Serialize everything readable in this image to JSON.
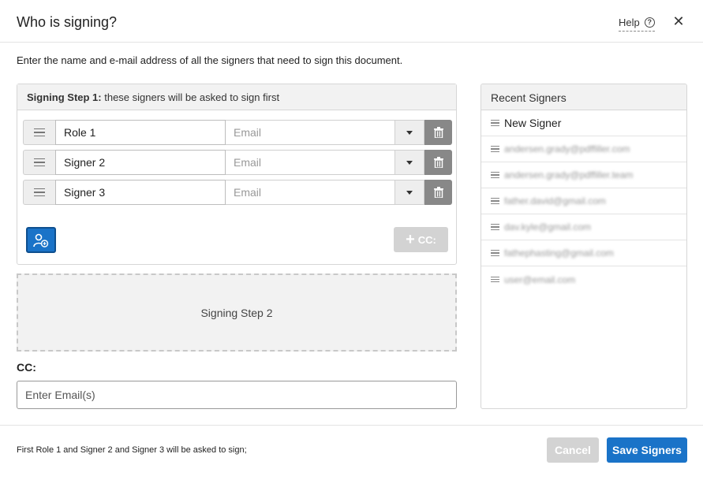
{
  "dialog": {
    "title": "Who is signing?",
    "help_label": "Help",
    "help_icon": "question-circle-icon",
    "close_icon": "close-icon"
  },
  "instructions": "Enter the name and e-mail address of all the signers that need to sign this document.",
  "step1": {
    "heading_bold": "Signing Step 1:",
    "heading_rest": " these signers will be asked to sign first",
    "signers": [
      {
        "name": "Role 1",
        "email_placeholder": "Email"
      },
      {
        "name": "Signer 2",
        "email_placeholder": "Email"
      },
      {
        "name": "Signer 3",
        "email_placeholder": "Email"
      }
    ],
    "add_signer_icon": "add-user-icon",
    "cc_button_label": "CC:"
  },
  "step2": {
    "label": "Signing Step 2"
  },
  "cc": {
    "label": "CC:",
    "placeholder": "Enter Email(s)"
  },
  "recent": {
    "heading": "Recent Signers",
    "items": [
      {
        "label": "New Signer"
      },
      {
        "label": "andersen.grady@pdffiller.com"
      },
      {
        "label": "andersen.grady@pdffiller.team"
      },
      {
        "label": "father.david@gmail.com"
      },
      {
        "label": "dav.kyle@gmail.com"
      },
      {
        "label": "fathephasting@gmail.com"
      },
      {
        "label": "user@email.com"
      }
    ]
  },
  "footer": {
    "summary": "First Role 1 and Signer 2 and Signer 3 will be asked to sign;",
    "cancel_label": "Cancel",
    "save_label": "Save Signers"
  },
  "colors": {
    "primary": "#1a73c8",
    "disabled": "#d3d3d3",
    "trash_bg": "#888888"
  }
}
